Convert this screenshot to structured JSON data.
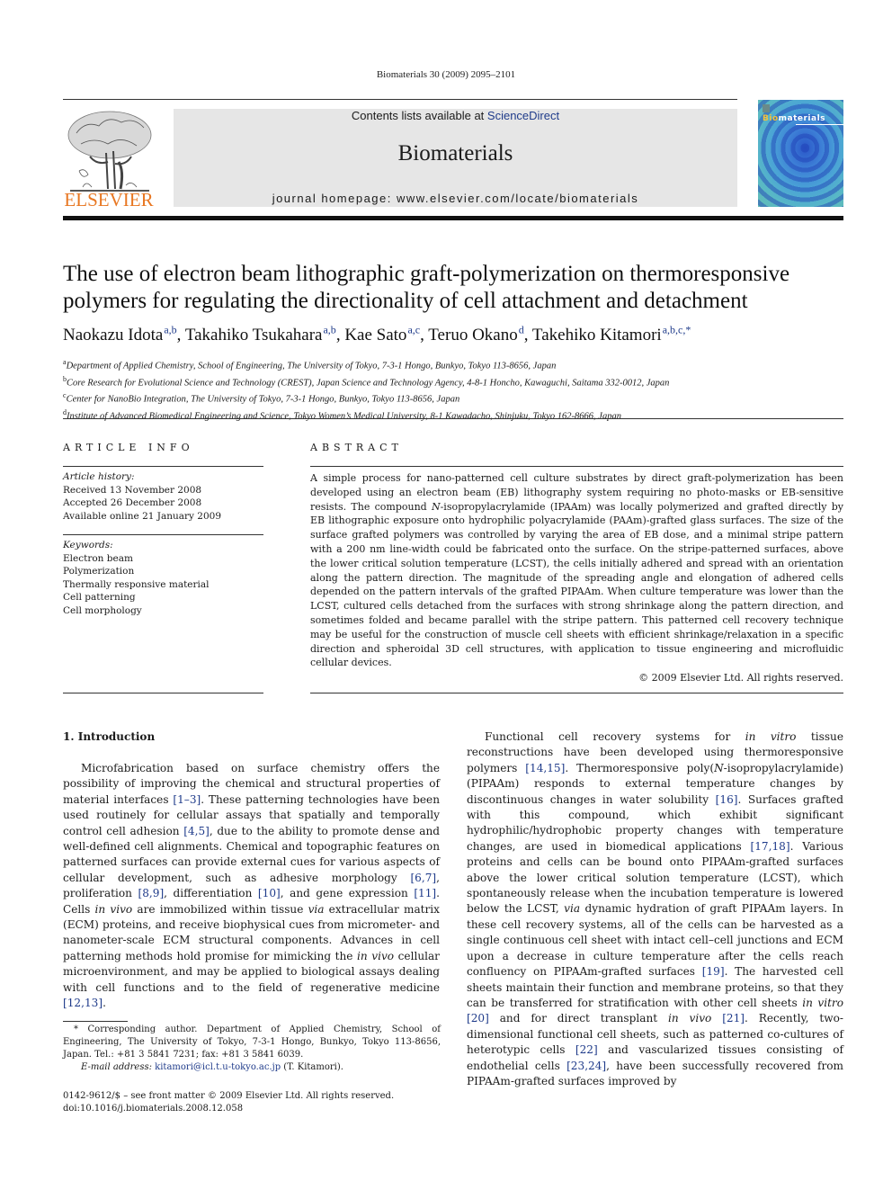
{
  "running_head": "Biomaterials 30 (2009) 2095–2101",
  "masthead": {
    "contents_prefix": "Contents lists available at ",
    "contents_link": "ScienceDirect",
    "journal_name": "Biomaterials",
    "homepage": "journal homepage: www.elsevier.com/locate/biomaterials",
    "publisher_logo_text": "ELSEVIER",
    "cover_title_accent": "Bio",
    "cover_title_rest": "materials",
    "brand_orange": "#e87722",
    "link_color": "#1f3b8a"
  },
  "article": {
    "title": "The use of electron beam lithographic graft-polymerization on thermoresponsive polymers for regulating the directionality of cell attachment and detachment",
    "authors": [
      {
        "name": "Naokazu Idota",
        "aff": "a,b"
      },
      {
        "name": "Takahiko Tsukahara",
        "aff": "a,b"
      },
      {
        "name": "Kae Sato",
        "aff": "a,c"
      },
      {
        "name": "Teruo Okano",
        "aff": "d"
      },
      {
        "name": "Takehiko Kitamori",
        "aff": "a,b,c,*"
      }
    ],
    "affiliations": [
      {
        "key": "a",
        "text": "Department of Applied Chemistry, School of Engineering, The University of Tokyo, 7-3-1 Hongo, Bunkyo, Tokyo 113-8656, Japan"
      },
      {
        "key": "b",
        "text": "Core Research for Evolutional Science and Technology (CREST), Japan Science and Technology Agency, 4-8-1 Honcho, Kawaguchi, Saitama 332-0012, Japan"
      },
      {
        "key": "c",
        "text": "Center for NanoBio Integration, The University of Tokyo, 7-3-1 Hongo, Bunkyo, Tokyo 113-8656, Japan"
      },
      {
        "key": "d",
        "text": "Institute of Advanced Biomedical Engineering and Science, Tokyo Women’s Medical University, 8-1 Kawadacho, Shinjuku, Tokyo 162-8666, Japan"
      }
    ]
  },
  "article_info": {
    "heading": "ARTICLE INFO",
    "history_label": "Article history:",
    "history": [
      "Received 13 November 2008",
      "Accepted 26 December 2008",
      "Available online 21 January 2009"
    ],
    "keywords_label": "Keywords:",
    "keywords": [
      "Electron beam",
      "Polymerization",
      "Thermally responsive material",
      "Cell patterning",
      "Cell morphology"
    ]
  },
  "abstract": {
    "heading": "ABSTRACT",
    "p1": "A simple process for nano-patterned cell culture substrates by direct graft-polymerization has been developed using an electron beam (EB) lithography system requiring no photo-masks or EB-sensitive resists. The compound ",
    "n_italic": "N",
    "p2": "-isopropylacrylamide (IPAAm) was locally polymerized and grafted directly by EB lithographic exposure onto hydrophilic polyacrylamide (PAAm)-grafted glass surfaces. The size of the surface grafted polymers was controlled by varying the area of EB dose, and a minimal stripe pattern with a 200 nm line-width could be fabricated onto the surface. On the stripe-patterned surfaces, above the lower critical solution temperature (LCST), the cells initially adhered and spread with an orientation along the pattern direction. The magnitude of the spreading angle and elongation of adhered cells depended on the pattern intervals of the grafted PIPAAm. When culture temperature was lower than the LCST, cultured cells detached from the surfaces with strong shrinkage along the pattern direction, and sometimes folded and became parallel with the stripe pattern. This patterned cell recovery technique may be useful for the construction of muscle cell sheets with efficient shrinkage/relaxation in a specific direction and spheroidal 3D cell structures, with application to tissue engineering and microfluidic cellular devices.",
    "copyright": "© 2009 Elsevier Ltd. All rights reserved."
  },
  "intro": {
    "heading": "1.  Introduction",
    "left_segments": [
      {
        "t": "Microfabrication based on surface chemistry offers the possibility of improving the chemical and structural properties of material interfaces "
      },
      {
        "ref": "[1–3]"
      },
      {
        "t": ". These patterning technologies have been used routinely for cellular assays that spatially and temporally control cell adhesion "
      },
      {
        "ref": "[4,5]"
      },
      {
        "t": ", due to the ability to promote dense and well-defined cell alignments. Chemical and topographic features on patterned surfaces can provide external cues for various aspects of cellular development, such as adhesive morphology "
      },
      {
        "ref": "[6,7]"
      },
      {
        "t": ", proliferation "
      },
      {
        "ref": "[8,9]"
      },
      {
        "t": ", differentiation "
      },
      {
        "ref": "[10]"
      },
      {
        "t": ", and gene expression "
      },
      {
        "ref": "[11]"
      },
      {
        "t": ". Cells "
      },
      {
        "i": "in vivo"
      },
      {
        "t": " are immobilized within tissue "
      },
      {
        "i": "via"
      },
      {
        "t": " extracellular matrix (ECM) proteins, and receive biophysical cues from micrometer- and nanometer-scale ECM structural components. Advances in cell patterning methods hold promise for mimicking the "
      },
      {
        "i": "in vivo"
      },
      {
        "t": " cellular microenvironment, and may be applied to biological assays dealing with cell functions and to the field of regenerative medicine "
      },
      {
        "ref": "[12,13]"
      },
      {
        "t": "."
      }
    ],
    "right_segments": [
      {
        "t": "Functional cell recovery systems for "
      },
      {
        "i": "in vitro"
      },
      {
        "t": " tissue reconstructions have been developed using thermoresponsive polymers "
      },
      {
        "ref": "[14,15]"
      },
      {
        "t": ". Thermoresponsive poly("
      },
      {
        "i": "N"
      },
      {
        "t": "-isopropylacrylamide) (PIPAAm) responds to external temperature changes by discontinuous changes in water solubility "
      },
      {
        "ref": "[16]"
      },
      {
        "t": ". Surfaces grafted with this compound, which exhibit significant hydrophilic/hydrophobic property changes with temperature changes, are used in biomedical applications "
      },
      {
        "ref": "[17,18]"
      },
      {
        "t": ". Various proteins and cells can be bound onto PIPAAm-grafted surfaces above the lower critical solution temperature (LCST), which spontaneously release when the incubation temperature is lowered below the LCST, "
      },
      {
        "i": "via"
      },
      {
        "t": " dynamic hydration of graft PIPAAm layers. In these cell recovery systems, all of the cells can be harvested as a single continuous cell sheet with intact cell–cell junctions and ECM upon a decrease in culture temperature after the cells reach confluency on PIPAAm-grafted surfaces "
      },
      {
        "ref": "[19]"
      },
      {
        "t": ". The harvested cell sheets maintain their function and membrane proteins, so that they can be transferred for stratification with other cell sheets "
      },
      {
        "i": "in vitro"
      },
      {
        "t": " "
      },
      {
        "ref": "[20]"
      },
      {
        "t": " and for direct transplant "
      },
      {
        "i": "in vivo"
      },
      {
        "t": " "
      },
      {
        "ref": "[21]"
      },
      {
        "t": ". Recently, two-dimensional functional cell sheets, such as patterned co-cultures of heterotypic cells "
      },
      {
        "ref": "[22]"
      },
      {
        "t": " and vascularized tissues consisting of endothelial cells "
      },
      {
        "ref": "[23,24]"
      },
      {
        "t": ", have been successfully recovered from PIPAAm-grafted surfaces improved by"
      }
    ]
  },
  "footnote": {
    "corresponding": "* Corresponding author. Department of Applied Chemistry, School of Engineering, The University of Tokyo, 7-3-1 Hongo, Bunkyo, Tokyo 113-8656, Japan. Tel.: +81 3 5841 7231; fax: +81 3 5841 6039.",
    "email_label": "E-mail address:",
    "email": "kitamori@icl.t.u-tokyo.ac.jp",
    "email_suffix": " (T. Kitamori).",
    "front_matter": "0142-9612/$ – see front matter © 2009 Elsevier Ltd. All rights reserved.",
    "doi": "doi:10.1016/j.biomaterials.2008.12.058"
  }
}
